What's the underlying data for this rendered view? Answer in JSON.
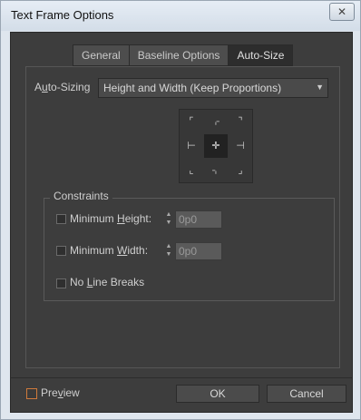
{
  "window": {
    "title": "Text Frame Options",
    "close_glyph": "✕"
  },
  "tabs": [
    {
      "label": "General",
      "selected": false
    },
    {
      "label": "Baseline Options",
      "selected": false
    },
    {
      "label": "Auto-Size",
      "selected": true
    }
  ],
  "auto_sizing": {
    "label_pre": "A",
    "label_ul": "u",
    "label_post": "to-Sizing",
    "value": "Height and Width (Keep Proportions)",
    "arrow_glyph": "▼"
  },
  "reference_points": {
    "glyphs": [
      "⌜",
      "⌌",
      "⌝",
      "⊢",
      "✛",
      "⊣",
      "⌞",
      "⌍",
      "⌟"
    ],
    "selected_index": 4
  },
  "constraints": {
    "legend": "Constraints",
    "minimum_height": {
      "pre": "Minimum ",
      "ul": "H",
      "post": "eight:",
      "value": "0p0",
      "checked": false
    },
    "minimum_width": {
      "pre": "Minimum ",
      "ul": "W",
      "post": "idth:",
      "value": "0p0",
      "checked": false
    },
    "no_line_breaks": {
      "pre": "No ",
      "ul": "L",
      "post": "ine Breaks",
      "checked": false
    }
  },
  "stepper": {
    "up": "▲",
    "down": "▼"
  },
  "footer": {
    "preview": {
      "pre": "Pre",
      "ul": "v",
      "post": "iew",
      "checked": false
    },
    "ok_label": "OK",
    "cancel_label": "Cancel"
  },
  "colors": {
    "dialog_bg": "#3d3d3d",
    "preview_accent": "#cf7a3c"
  }
}
